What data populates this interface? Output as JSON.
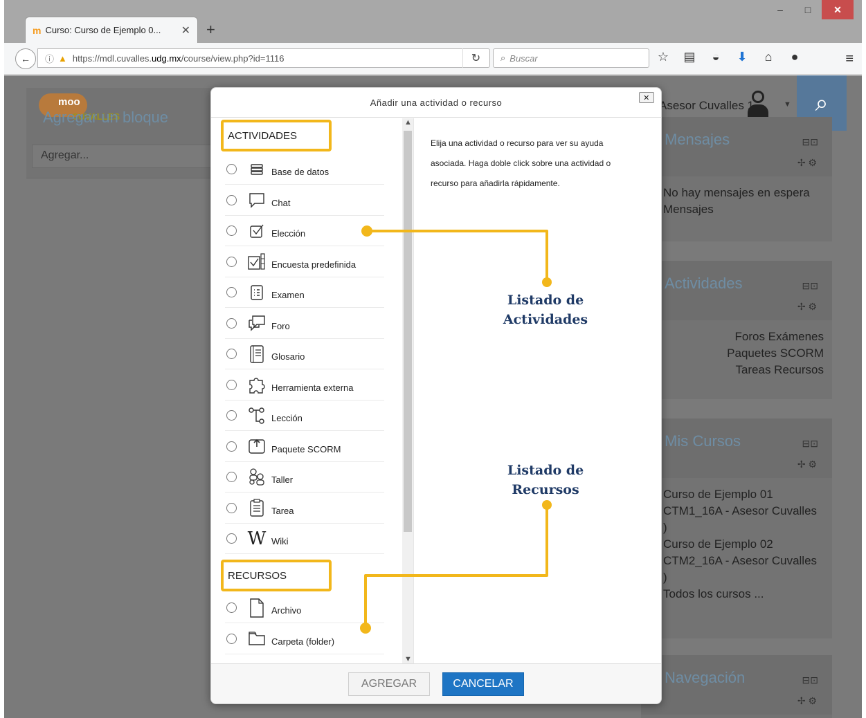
{
  "browser": {
    "tab_title": "Curso: Curso de Ejemplo 0...",
    "tab_close": "✕",
    "new_tab": "+",
    "url_prefix": "https://mdl.cuvalles.",
    "url_host": "udg.mx",
    "url_path": "/course/view.php?id=1116",
    "search_placeholder": "Buscar",
    "window_controls": [
      "–",
      "□",
      "✕"
    ]
  },
  "page": {
    "agregar_bloque": "Agregar un bloque",
    "agregar_select": "Agregar...",
    "user_name": "Asesor Cuvalles 1",
    "blocks": [
      {
        "title": "Mensajes",
        "lines": [
          "No hay mensajes en espera",
          "Mensajes"
        ]
      },
      {
        "title": "Actividades",
        "lines": [
          "Foros Exámenes",
          "Paquetes SCORM",
          "Tareas Recursos"
        ]
      },
      {
        "title": "Mis Cursos",
        "lines": [
          "Curso de Ejemplo 01",
          "CTM1_16A - Asesor Cuvalles",
          ")",
          "Curso de Ejemplo 02",
          "CTM2_16A - Asesor Cuvalles",
          ")",
          "Todos los cursos ..."
        ]
      },
      {
        "title": "Navegación",
        "lines": []
      }
    ]
  },
  "modal": {
    "title": "Añadir una actividad o recurso",
    "close": "✕",
    "help_text": "Elija una actividad o recurso para ver su ayuda asociada. Haga doble click sobre una actividad o recurso para añadirla rápidamente.",
    "section_actividades": "ACTIVIDADES",
    "section_recursos": "RECURSOS",
    "actividades": [
      {
        "label": "Base de datos",
        "icon": "database-icon"
      },
      {
        "label": "Chat",
        "icon": "chat-icon"
      },
      {
        "label": "Elección",
        "icon": "choice-icon"
      },
      {
        "label": "Encuesta predefinida",
        "icon": "survey-icon"
      },
      {
        "label": "Examen",
        "icon": "quiz-icon"
      },
      {
        "label": "Foro",
        "icon": "forum-icon"
      },
      {
        "label": "Glosario",
        "icon": "glossary-icon"
      },
      {
        "label": "Herramienta externa",
        "icon": "puzzle-icon"
      },
      {
        "label": "Lección",
        "icon": "lesson-icon"
      },
      {
        "label": "Paquete SCORM",
        "icon": "scorm-icon"
      },
      {
        "label": "Taller",
        "icon": "workshop-icon"
      },
      {
        "label": "Tarea",
        "icon": "assignment-icon"
      },
      {
        "label": "Wiki",
        "icon": "wiki-icon"
      }
    ],
    "recursos": [
      {
        "label": "Archivo",
        "icon": "file-icon"
      },
      {
        "label": "Carpeta (folder)",
        "icon": "folder-icon"
      }
    ],
    "btn_agregar": "AGREGAR",
    "btn_cancelar": "CANCELAR"
  },
  "annotations": {
    "actividades_label": "Listado de Actividades",
    "recursos_label": "Listado de Recursos",
    "highlight_color": "#f2b71b",
    "label_color": "#1f3a66"
  }
}
